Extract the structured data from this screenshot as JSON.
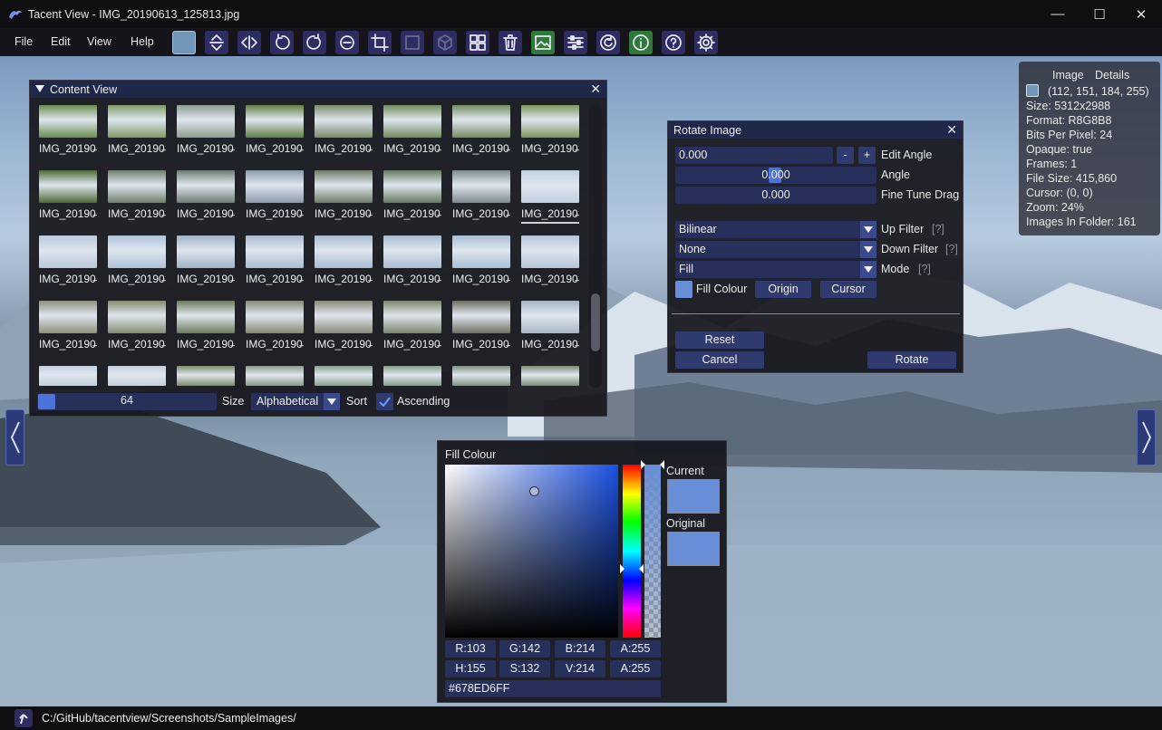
{
  "window": {
    "title": "Tacent View - IMG_20190613_125813.jpg",
    "minimize": "—",
    "maximize": "☐",
    "close": "✕"
  },
  "menu": [
    "File",
    "Edit",
    "View",
    "Help"
  ],
  "toolbar": [
    "colour-swatch",
    "flip-vertical",
    "flip-horizontal",
    "rotate-anticlockwise",
    "rotate-clockwise",
    "zoom-out",
    "crop",
    "fit-screen",
    "3d-cube",
    "content-view",
    "delete",
    "tile-image",
    "sliders",
    "refresh",
    "info",
    "help",
    "settings"
  ],
  "content_view": {
    "title": "Content View",
    "thumb_label": "IMG_20190̶",
    "rows": [
      {
        "colors": [
          "#6a8c4f",
          "#7f9a66",
          "#8e9c90",
          "#5f7f45",
          "#7a8a6a",
          "#6f8a5c",
          "#748c62",
          "#7c955b"
        ]
      },
      {
        "colors": [
          "#4d6a35",
          "#6f7f6a",
          "#6c7c73",
          "#8a9aaa",
          "#6f7a66",
          "#66795f",
          "#7d8a8f",
          "#bfd0e0"
        ]
      },
      {
        "colors": [
          "#b8c8d8",
          "#aec4d9",
          "#9fb2c4",
          "#a9bccd",
          "#a7bbcf",
          "#a8bdd1",
          "#a9bfd3",
          "#b5c5d6"
        ]
      },
      {
        "colors": [
          "#8e8f7c",
          "#848c6f",
          "#6b7b5c",
          "#858a72",
          "#8a8a78",
          "#7b866a",
          "#6d6f5e",
          "#a7b6c4"
        ]
      },
      {
        "colors": [
          "#c4d0de",
          "#c6d1dd",
          "#7d8c6a",
          "#8a9a88",
          "#8aa08d",
          "#889c8a",
          "#7f937f",
          "#7a8e76"
        ]
      }
    ],
    "size_value": "64",
    "size_label": "Size",
    "sort_value": "Alphabetical",
    "sort_label": "Sort",
    "ascending_label": "Ascending",
    "ascending_checked": true
  },
  "rotate": {
    "title": "Rotate Image",
    "edit_angle_value": "0.000",
    "minus": "-",
    "plus": "+",
    "edit_angle_label": "Edit Angle",
    "angle_value": "0.000",
    "angle_label": "Angle",
    "fine_tune_value": "0.000",
    "fine_tune_label": "Fine Tune Drag",
    "up_filter_value": "Bilinear",
    "up_filter_label": "Up Filter",
    "down_filter_value": "None",
    "down_filter_label": "Down Filter",
    "mode_value": "Fill",
    "mode_label": "Mode",
    "help_marker": "[?]",
    "fill_colour_label": "Fill Colour",
    "origin_label": "Origin",
    "cursor_label": "Cursor",
    "reset_label": "Reset",
    "cancel_label": "Cancel",
    "rotate_label": "Rotate"
  },
  "details": {
    "header_image": "Image",
    "header_details": "Details",
    "rgba": "(112, 151, 184, 255)",
    "swatch_color": "#7097b8",
    "lines": [
      "Size: 5312x2988",
      "Format: R8G8B8",
      "Bits Per Pixel: 24",
      "Opaque: true",
      "Frames: 1",
      "File Size: 415,860",
      "Cursor: (0, 0)",
      "Zoom: 24%",
      "Images In Folder: 161"
    ]
  },
  "fill_colour": {
    "title": "Fill Colour",
    "current_label": "Current",
    "original_label": "Original",
    "color": "#678ED6",
    "r": "R:103",
    "g": "G:142",
    "b": "B:214",
    "a": "A:255",
    "h": "H:155",
    "s": "S:132",
    "v": "V:214",
    "a2": "A:255",
    "hex": "#678ED6FF"
  },
  "status": {
    "path": "C:/GitHub/tacentview/Screenshots/SampleImages/"
  }
}
